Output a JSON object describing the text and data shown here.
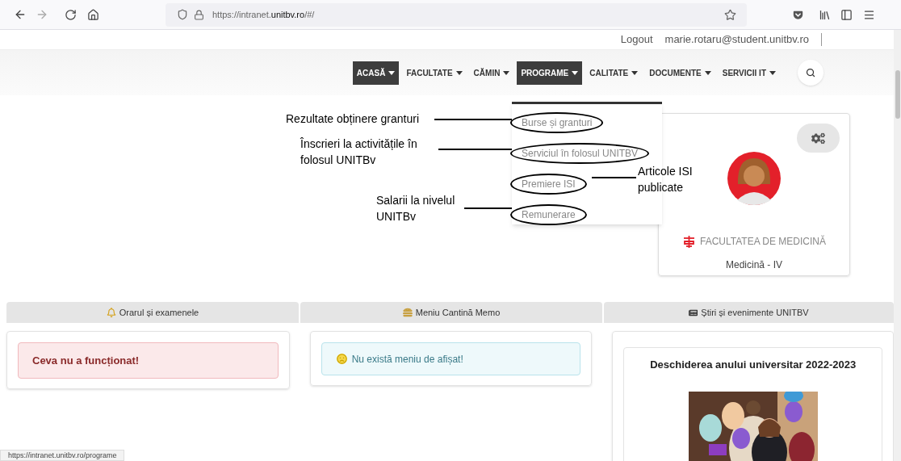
{
  "browser": {
    "url": {
      "prefix": "https://intranet.",
      "domain": "unitbv.ro",
      "suffix": "/#/"
    }
  },
  "account": {
    "logout": "Logout",
    "email": "marie.rotaru@student.unitbv.ro"
  },
  "nav": [
    {
      "label": "ACASĂ",
      "selected": true
    },
    {
      "label": "FACULTATE",
      "selected": false
    },
    {
      "label": "CĂMIN",
      "selected": false
    },
    {
      "label": "PROGRAME",
      "selected": true
    },
    {
      "label": "CALITATE",
      "selected": false
    },
    {
      "label": "DOCUMENTE",
      "selected": false
    },
    {
      "label": "SERVICII IT",
      "selected": false
    }
  ],
  "dropdown": {
    "items": [
      {
        "label": "Burse și granturi",
        "circled": true
      },
      {
        "label": "Serviciul în folosul UNITBV",
        "circled": true
      },
      {
        "label": "Premiere ISI",
        "circled": true
      },
      {
        "label": "Remunerare",
        "circled": true
      }
    ]
  },
  "annotations": [
    {
      "text": "Rezultate obținere granturi"
    },
    {
      "text": "Înscrieri la activitățile în\nfolosul UNITBv"
    },
    {
      "text": "Articole ISI\npublicate"
    },
    {
      "text": "Salarii la nivelul\nUNITBv"
    }
  ],
  "profile": {
    "faculty": "FACULTATEA DE MEDICINĂ",
    "program": "Medicină - IV"
  },
  "sections": [
    {
      "title": "Orarul și examenele",
      "kind": "schedule",
      "alert": {
        "kind": "error",
        "text": "Ceva nu a funcționat!"
      }
    },
    {
      "title": "Meniu Cantină Memo",
      "kind": "menu",
      "alert": {
        "kind": "info",
        "text": "Nu există meniu de afișat!"
      }
    },
    {
      "title": "Știri și evenimente UNITBV",
      "kind": "news",
      "news": {
        "title": "Deschiderea anului universitar 2022-2023"
      }
    }
  ],
  "status_url": "https://intranet.unitbv.ro/programe"
}
